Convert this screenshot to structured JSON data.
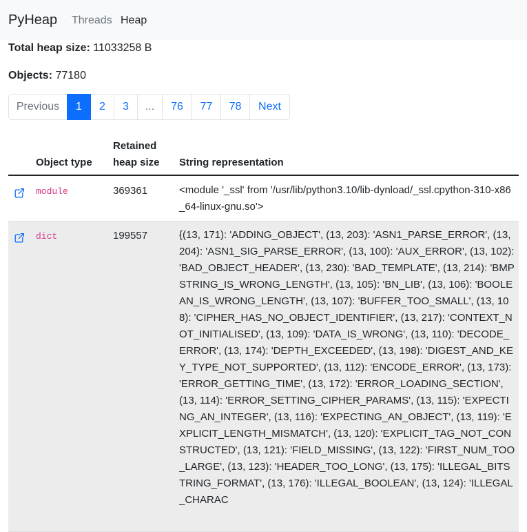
{
  "navbar": {
    "brand": "PyHeap",
    "links": [
      {
        "label": "Threads",
        "active": false
      },
      {
        "label": "Heap",
        "active": true
      }
    ]
  },
  "stats": {
    "total_heap_label": "Total heap size:",
    "total_heap_value": "11033258 B",
    "objects_label": "Objects:",
    "objects_value": "77180"
  },
  "pagination": {
    "items": [
      {
        "label": "Previous",
        "state": "disabled"
      },
      {
        "label": "1",
        "state": "active"
      },
      {
        "label": "2",
        "state": "normal"
      },
      {
        "label": "3",
        "state": "normal"
      },
      {
        "label": "...",
        "state": "disabled"
      },
      {
        "label": "76",
        "state": "normal"
      },
      {
        "label": "77",
        "state": "normal"
      },
      {
        "label": "78",
        "state": "normal"
      },
      {
        "label": "Next",
        "state": "normal"
      }
    ]
  },
  "table": {
    "headers": {
      "object_type": "Object type",
      "retained_heap_size_line1": "Retained",
      "retained_heap_size_line2": "heap size",
      "string_representation": "String representation"
    },
    "rows": [
      {
        "icon": "external-link-icon",
        "type": "module",
        "size": "369361",
        "repr": "<module '_ssl' from '/usr/lib/python3.10/lib-dynload/_ssl.cpython-310-x86_64-linux-gnu.so'>"
      },
      {
        "icon": "external-link-icon",
        "type": "dict",
        "size": "199557",
        "repr": "{(13, 171): 'ADDING_OBJECT', (13, 203): 'ASN1_PARSE_ERROR', (13, 204): 'ASN1_SIG_PARSE_ERROR', (13, 100): 'AUX_ERROR', (13, 102): 'BAD_OBJECT_HEADER', (13, 230): 'BAD_TEMPLATE', (13, 214): 'BMPSTRING_IS_WRONG_LENGTH', (13, 105): 'BN_LIB', (13, 106): 'BOOLEAN_IS_WRONG_LENGTH', (13, 107): 'BUFFER_TOO_SMALL', (13, 108): 'CIPHER_HAS_NO_OBJECT_IDENTIFIER', (13, 217): 'CONTEXT_NOT_INITIALISED', (13, 109): 'DATA_IS_WRONG', (13, 110): 'DECODE_ERROR', (13, 174): 'DEPTH_EXCEEDED', (13, 198): 'DIGEST_AND_KEY_TYPE_NOT_SUPPORTED', (13, 112): 'ENCODE_ERROR', (13, 173): 'ERROR_GETTING_TIME', (13, 172): 'ERROR_LOADING_SECTION', (13, 114): 'ERROR_SETTING_CIPHER_PARAMS', (13, 115): 'EXPECTING_AN_INTEGER', (13, 116): 'EXPECTING_AN_OBJECT', (13, 119): 'EXPLICIT_LENGTH_MISMATCH', (13, 120): 'EXPLICIT_TAG_NOT_CONSTRUCTED', (13, 121): 'FIELD_MISSING', (13, 122): 'FIRST_NUM_TOO_LARGE', (13, 123): 'HEADER_TOO_LONG', (13, 175): 'ILLEGAL_BITSTRING_FORMAT', (13, 176): 'ILLEGAL_BOOLEAN', (13, 124): 'ILLEGAL_CHARAC"
      }
    ]
  },
  "colors": {
    "link": "#0d6efd",
    "muted": "#6c757d",
    "code": "#d63384",
    "navbar_bg": "#f8f9fa",
    "striped_row_bg": "#ececec"
  }
}
